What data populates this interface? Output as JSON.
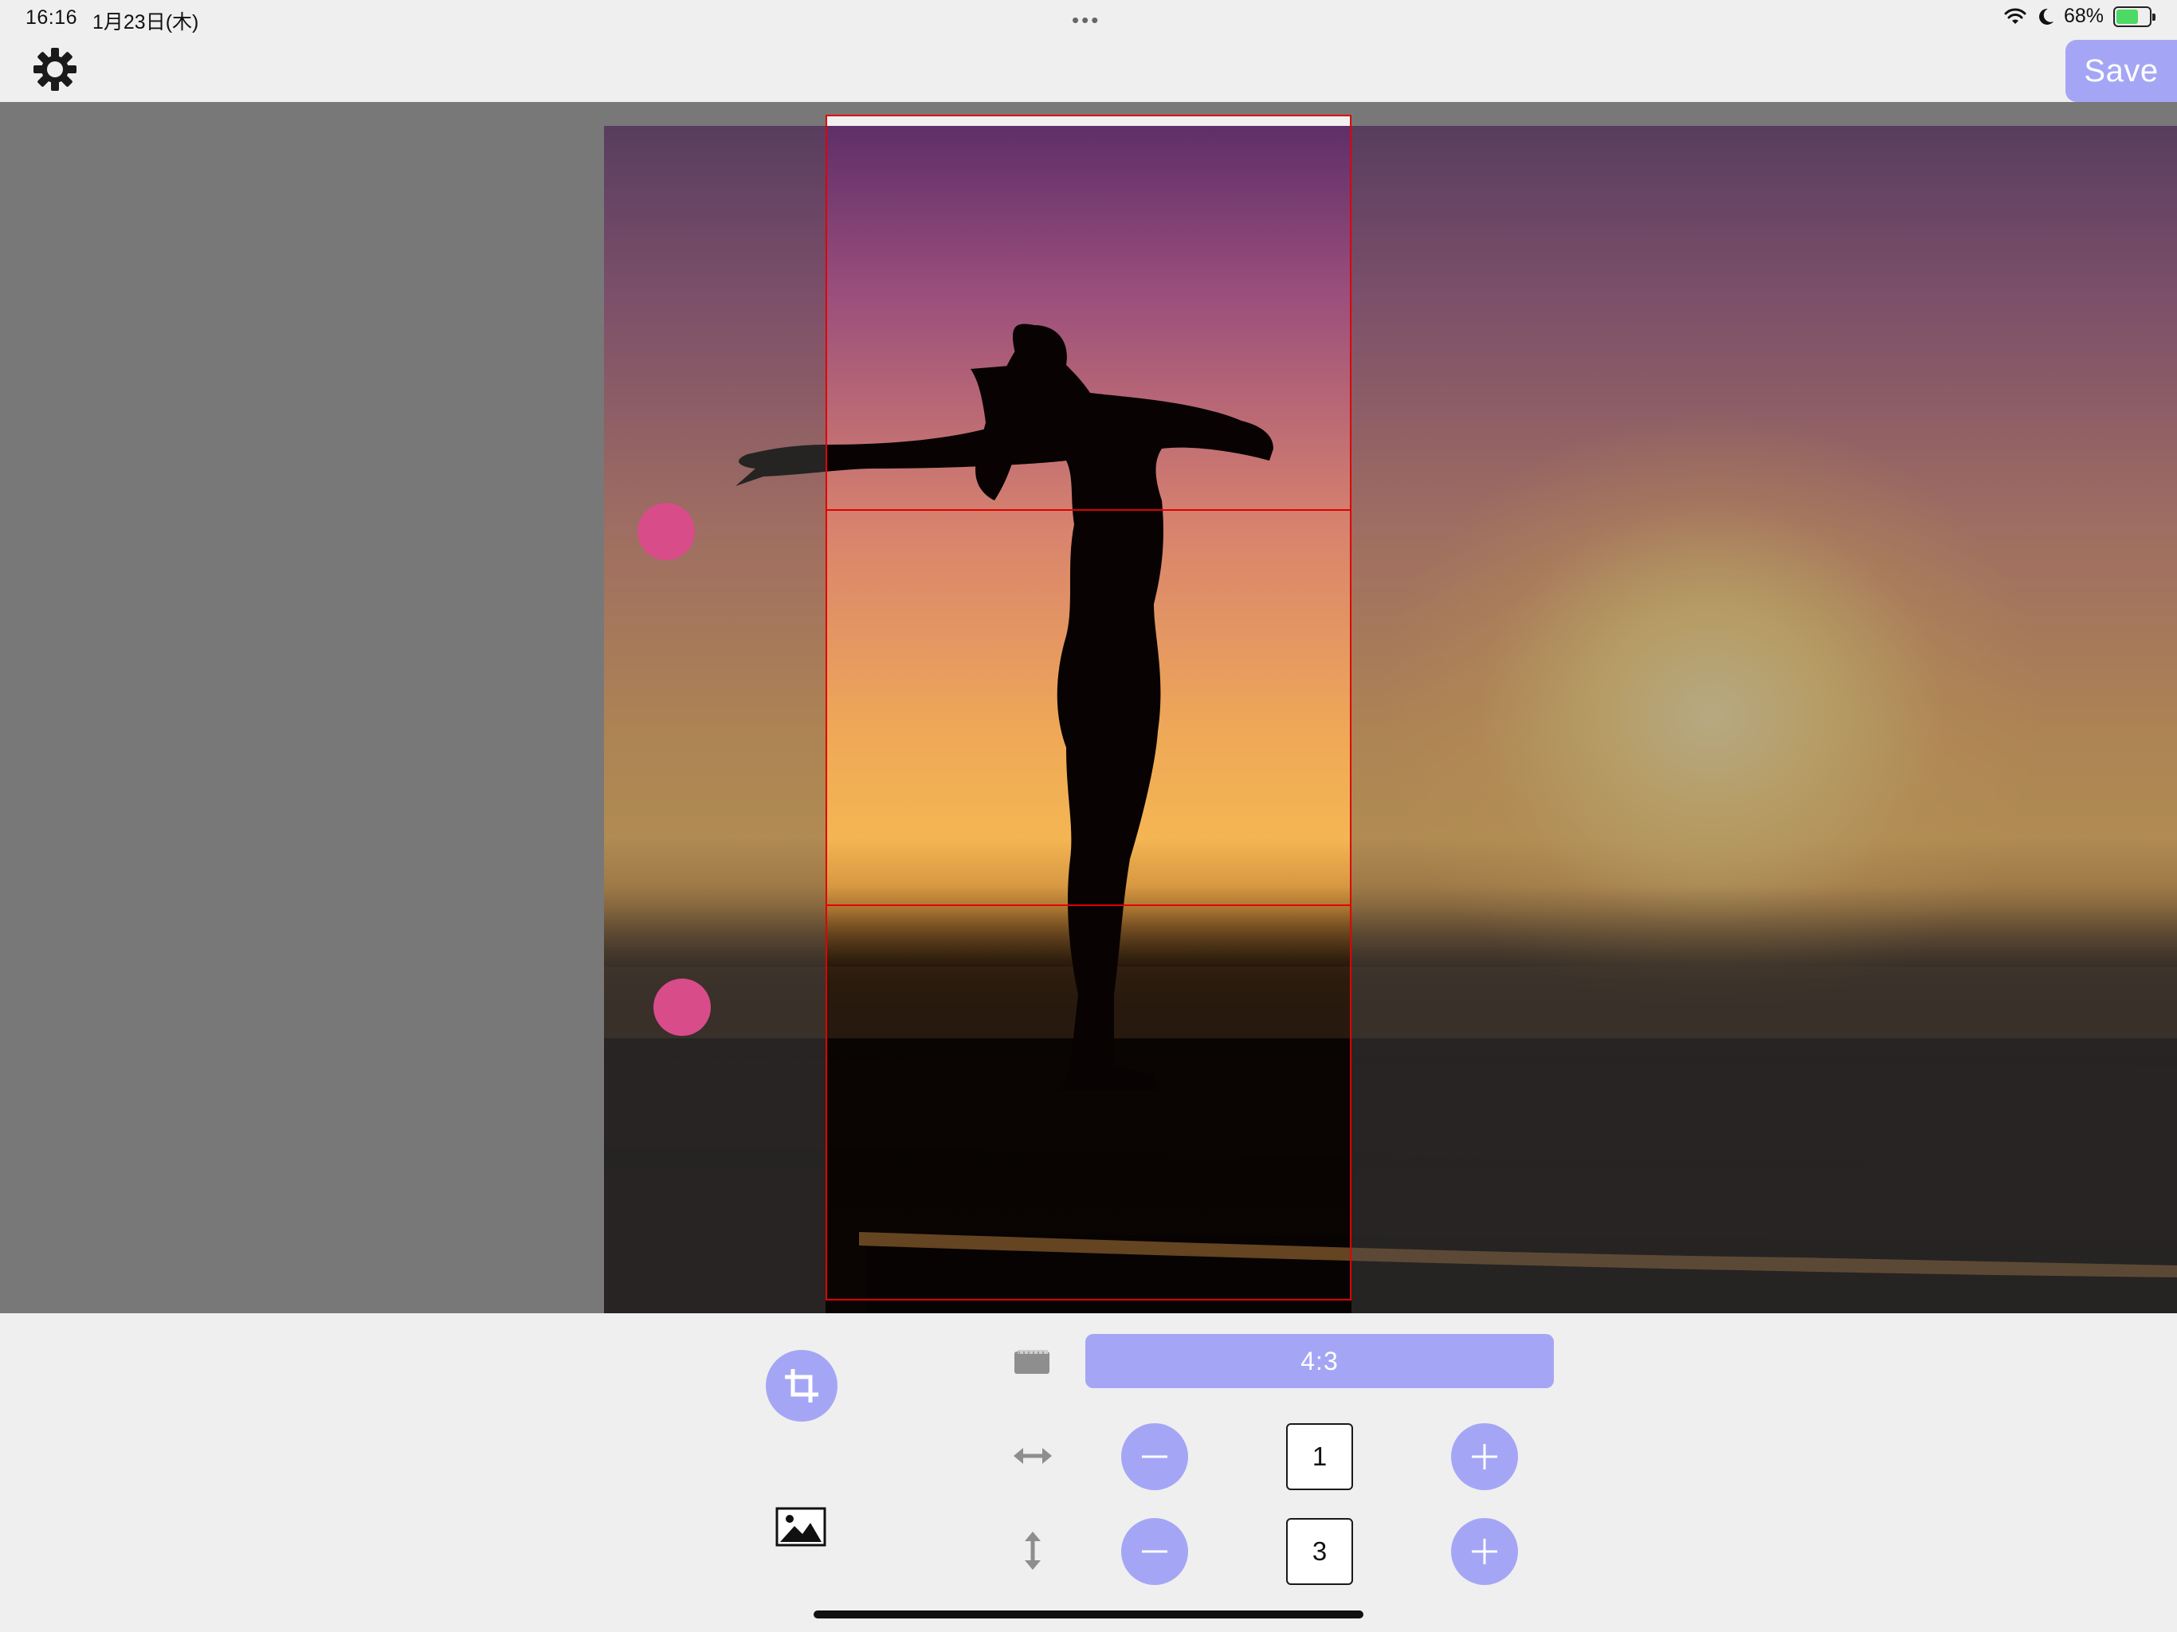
{
  "status_bar": {
    "time": "16:16",
    "date": "1月23日(木)",
    "multitask_dots": "•••",
    "battery_percent": "68%",
    "battery_level": 0.68,
    "icons": [
      "wifi-icon",
      "moon-icon",
      "battery-charging-icon"
    ]
  },
  "toolbar": {
    "settings_icon": "gear-icon",
    "save_label": "Save"
  },
  "editor": {
    "grid_rows": 3,
    "grid_columns": 1,
    "accent_color": "#a4a6f5",
    "crop_line_color": "#e00000",
    "handle_color": "#d84c8a"
  },
  "controls": {
    "crop_tool_icon": "crop-icon",
    "image_picker_icon": "image-icon",
    "aspect_icon": "aspect-ratio-icon",
    "aspect_ratio_label": "4:3",
    "horizontal": {
      "icon": "horizontal-arrows-icon",
      "value": "1"
    },
    "vertical": {
      "icon": "vertical-arrows-icon",
      "value": "3"
    }
  }
}
